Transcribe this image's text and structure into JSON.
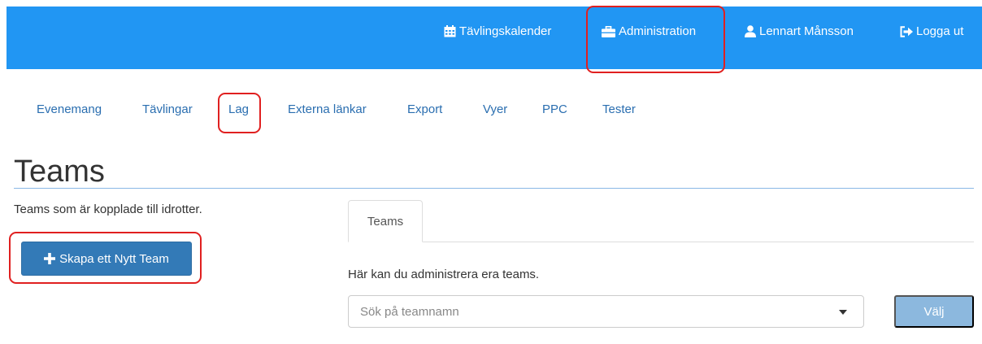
{
  "topbar": {
    "calendar_label": "Tävlingskalender",
    "admin_label": "Administration",
    "user_label": "Lennart Månsson",
    "logout_label": "Logga ut"
  },
  "subnav": {
    "items": [
      {
        "label": "Evenemang"
      },
      {
        "label": "Tävlingar"
      },
      {
        "label": "Lag"
      },
      {
        "label": "Externa länkar"
      },
      {
        "label": "Export"
      },
      {
        "label": "Vyer"
      },
      {
        "label": "PPC"
      },
      {
        "label": "Tester"
      }
    ]
  },
  "page": {
    "title": "Teams",
    "intro": "Teams som är kopplade till idrotter.",
    "create_button": "Skapa ett Nytt Team"
  },
  "panel": {
    "tab_label": "Teams",
    "help_text": "Här kan du administrera era teams.",
    "search_placeholder": "Sök på teamnamn",
    "select_button": "Välj"
  },
  "colors": {
    "topbar": "#2196f3",
    "link": "#2a6eb0",
    "primary_button": "#337ab7",
    "disabled_button": "#8cb8de",
    "highlight": "#e02020"
  }
}
